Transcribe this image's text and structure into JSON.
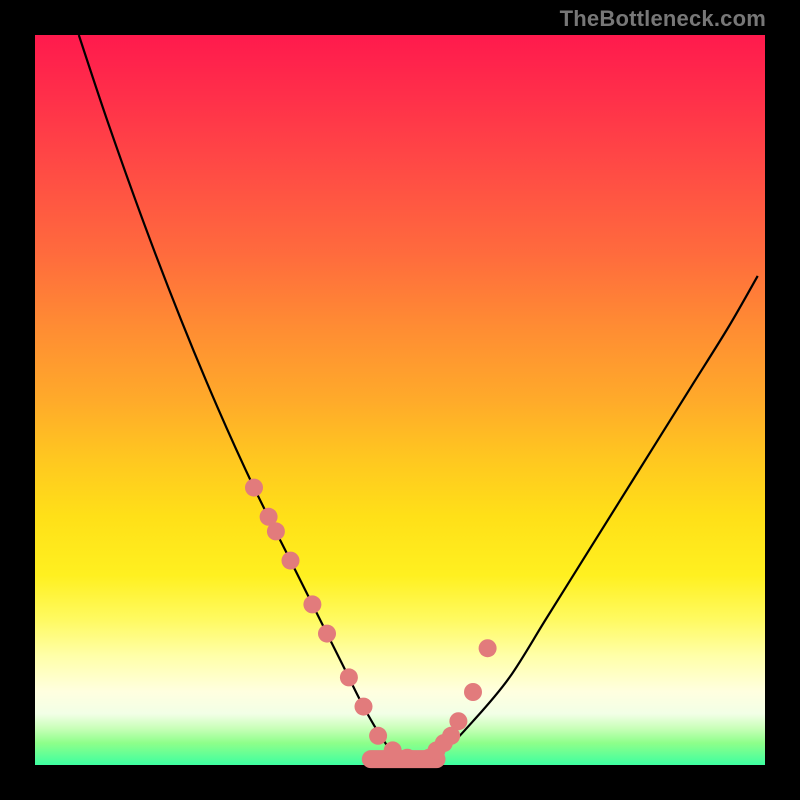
{
  "watermark": "TheBottleneck.com",
  "colors": {
    "frame": "#000000",
    "curve_stroke": "#000000",
    "marker_fill": "#e27b7c",
    "marker_stroke": "#d86f70",
    "gradient_top": "#ff1a4d",
    "gradient_bottom": "#3dffa0"
  },
  "chart_data": {
    "type": "line",
    "title": "",
    "xlabel": "",
    "ylabel": "",
    "xlim": [
      0,
      100
    ],
    "ylim": [
      0,
      100
    ],
    "series": [
      {
        "name": "bottleneck-curve",
        "x": [
          6,
          10,
          15,
          20,
          25,
          30,
          35,
          38,
          42,
          45,
          48,
          50,
          53,
          56,
          60,
          65,
          70,
          75,
          80,
          85,
          90,
          95,
          99
        ],
        "values": [
          100,
          88,
          74,
          61,
          49,
          38,
          28,
          22,
          14,
          8,
          3,
          1,
          1,
          2,
          6,
          12,
          20,
          28,
          36,
          44,
          52,
          60,
          67
        ]
      }
    ],
    "markers": {
      "name": "highlighted-points",
      "x": [
        30,
        32,
        33,
        35,
        38,
        40,
        43,
        45,
        47,
        49,
        51,
        54,
        55,
        56,
        57,
        58,
        60,
        62
      ],
      "values": [
        38,
        34,
        32,
        28,
        22,
        18,
        12,
        8,
        4,
        2,
        1,
        1,
        2,
        3,
        4,
        6,
        10,
        16
      ]
    }
  }
}
